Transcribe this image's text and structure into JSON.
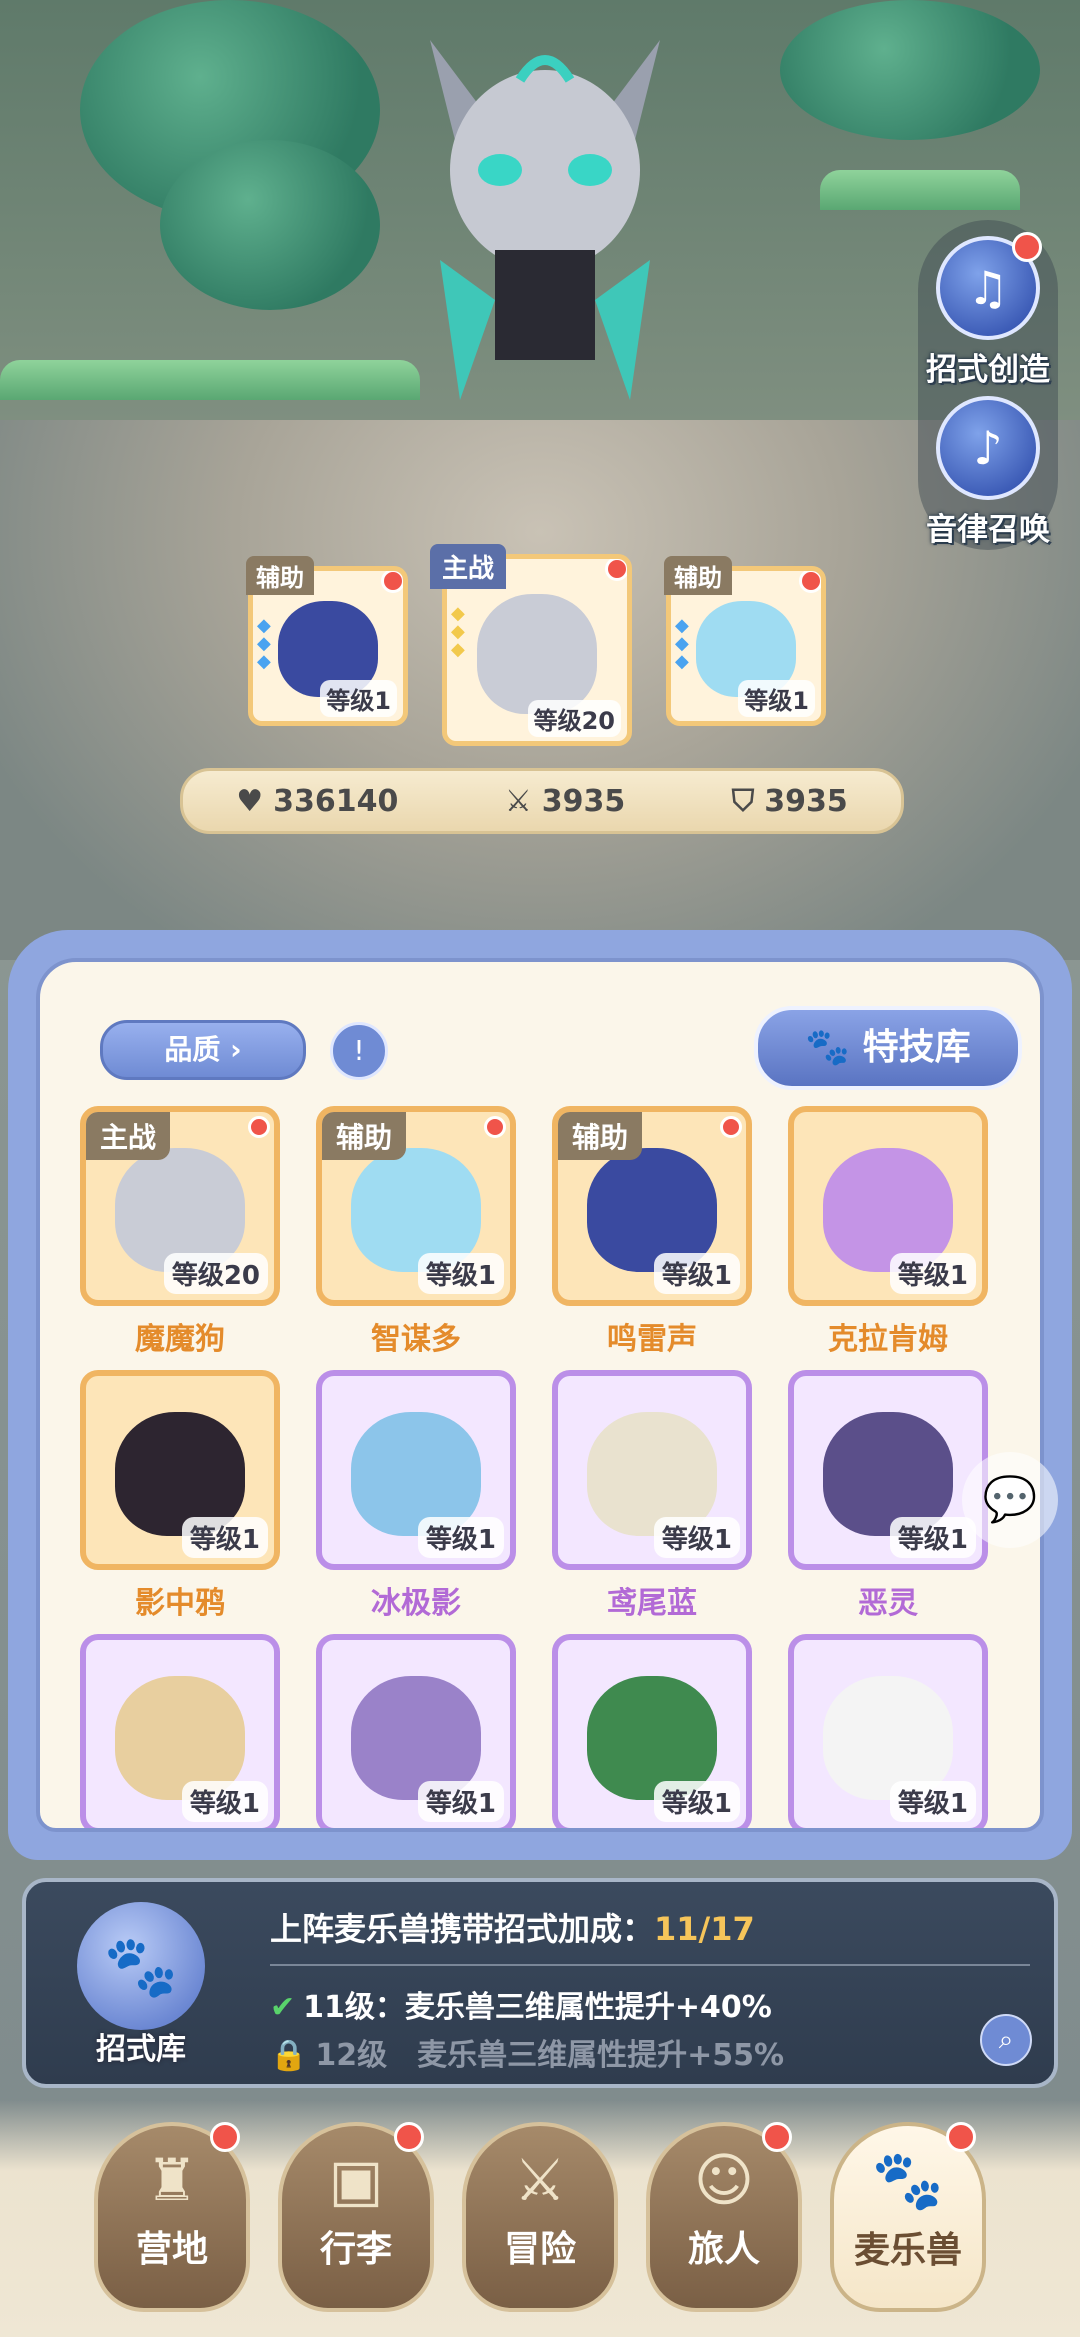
{
  "side_buttons": [
    {
      "label": "招式创造",
      "icon": "book-music-icon",
      "badge": true
    },
    {
      "label": "音律召唤",
      "icon": "harp-icon",
      "badge": false
    }
  ],
  "team": [
    {
      "role": "辅助",
      "level": "等级1",
      "color": "#3a4aa0"
    },
    {
      "role": "主战",
      "level": "等级20",
      "color": "#c9ccd6"
    },
    {
      "role": "辅助",
      "level": "等级1",
      "color": "#9fdcf2"
    }
  ],
  "stats": {
    "hp": "336140",
    "attack": "3935",
    "defense": "3935"
  },
  "filters": {
    "quality_label": "品质",
    "skill_library_label": "特技库"
  },
  "pets": [
    {
      "name": "魔魔狗",
      "level": "等级20",
      "tag": "主战",
      "rarity": "gold",
      "color": "#c9ccd6"
    },
    {
      "name": "智谋多",
      "level": "等级1",
      "tag": "辅助",
      "rarity": "gold",
      "color": "#9fdcf2"
    },
    {
      "name": "鸣雷声",
      "level": "等级1",
      "tag": "辅助",
      "rarity": "gold",
      "color": "#3a4aa0"
    },
    {
      "name": "克拉肯姆",
      "level": "等级1",
      "tag": "",
      "rarity": "gold",
      "color": "#c494e6"
    },
    {
      "name": "影中鸦",
      "level": "等级1",
      "tag": "",
      "rarity": "gold",
      "color": "#2d2530"
    },
    {
      "name": "冰极影",
      "level": "等级1",
      "tag": "",
      "rarity": "purple",
      "color": "#8cc5ea"
    },
    {
      "name": "鸢尾蓝",
      "level": "等级1",
      "tag": "",
      "rarity": "purple",
      "color": "#e9e2cf"
    },
    {
      "name": "恶灵",
      "level": "等级1",
      "tag": "",
      "rarity": "purple",
      "color": "#5b4f8a"
    },
    {
      "name": "",
      "level": "等级1",
      "tag": "",
      "rarity": "purple",
      "color": "#e8cf9f"
    },
    {
      "name": "",
      "level": "等级1",
      "tag": "",
      "rarity": "purple",
      "color": "#9a82c9"
    },
    {
      "name": "",
      "level": "等级1",
      "tag": "",
      "rarity": "purple",
      "color": "#3f8a4f"
    },
    {
      "name": "",
      "level": "等级1",
      "tag": "",
      "rarity": "purple",
      "color": "#f4f4f4"
    }
  ],
  "bonus": {
    "library_label": "招式库",
    "title": "上阵麦乐兽携带招式加成：",
    "count": "11/17",
    "unlocked": "11级：麦乐兽三维属性提升+40%",
    "locked": "12级　麦乐兽三维属性提升+55%"
  },
  "nav": [
    {
      "label": "营地",
      "icon": "castle-icon",
      "badge": true,
      "active": false
    },
    {
      "label": "行李",
      "icon": "bag-icon",
      "badge": true,
      "active": false
    },
    {
      "label": "冒险",
      "icon": "swords-icon",
      "badge": false,
      "active": false
    },
    {
      "label": "旅人",
      "icon": "traveler-icon",
      "badge": true,
      "active": false
    },
    {
      "label": "麦乐兽",
      "icon": "pet-icon",
      "badge": true,
      "active": true
    }
  ]
}
